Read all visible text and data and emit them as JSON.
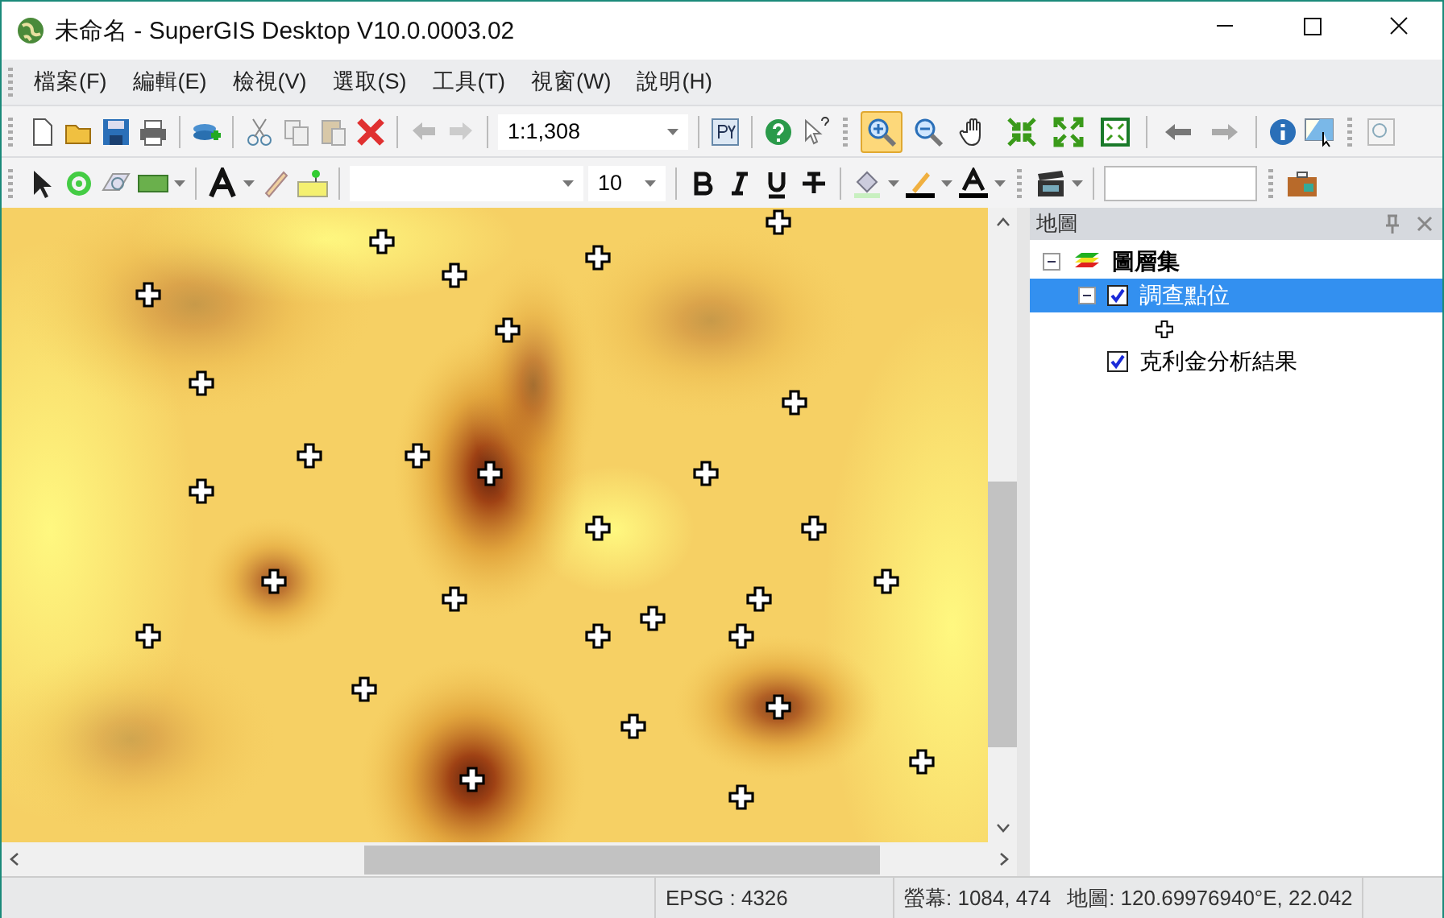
{
  "window": {
    "title": "未命名 - SuperGIS Desktop V10.0.0003.02"
  },
  "menu": [
    "檔案(F)",
    "編輯(E)",
    "檢視(V)",
    "選取(S)",
    "工具(T)",
    "視窗(W)",
    "說明(H)"
  ],
  "toolbar": {
    "scale": "1:1,308",
    "font_size": "10"
  },
  "map_tools": [
    {
      "selected": true
    },
    {
      "selected": false
    },
    {
      "selected": false
    },
    {
      "selected": false
    },
    {
      "selected": false
    },
    {
      "selected": false
    },
    {
      "selected": false
    },
    {
      "selected": false
    }
  ],
  "panel": {
    "title": "地圖",
    "tree": [
      {
        "label": "圖層集",
        "expanded": true,
        "children": [
          {
            "label": "調查點位",
            "checked": true,
            "selected": true,
            "expanded": true
          },
          {
            "label": "克利金分析結果",
            "checked": true,
            "selected": false
          }
        ]
      }
    ]
  },
  "status_bar": {
    "crs": "EPSG : 4326",
    "screen": "螢幕: 1084, 474",
    "map": "地圖: 120.69976940°E, 22.042"
  }
}
